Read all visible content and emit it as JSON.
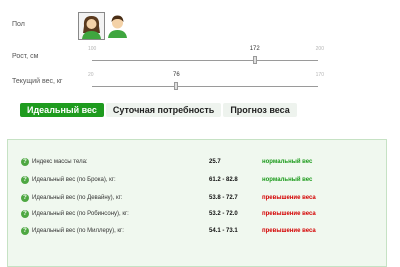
{
  "form": {
    "gender_label": "Пол",
    "height_label": "Рост, см",
    "weight_label": "Текущий вес, кг"
  },
  "gender": {
    "options": [
      "female",
      "male"
    ],
    "selected": "female"
  },
  "height_slider": {
    "min": "100",
    "max": "200",
    "value": "172"
  },
  "weight_slider": {
    "min": "20",
    "max": "170",
    "value": "76"
  },
  "tabs": [
    {
      "label": "Идеальный вес",
      "active": true
    },
    {
      "label": "Суточная потребность",
      "active": false
    },
    {
      "label": "Прогноз веса",
      "active": false
    }
  ],
  "colors": {
    "accent": "#1e9b1e",
    "ok": "#1a9a1a",
    "over": "#d40000"
  },
  "results": [
    {
      "label": "Индекс массы тела:",
      "value": "25.7",
      "status": "нормальный вес",
      "status_type": "ok"
    },
    {
      "label": "Идеальный вес (по Брока), кг:",
      "value": "61.2 - 82.8",
      "status": "нормальный вес",
      "status_type": "ok"
    },
    {
      "label": "Идеальный вес (по Девайну), кг:",
      "value": "53.8 - 72.7",
      "status": "превышение веса",
      "status_type": "over"
    },
    {
      "label": "Идеальный вес (по Робинсону), кг:",
      "value": "53.2 - 72.0",
      "status": "превышение веса",
      "status_type": "over"
    },
    {
      "label": "Идеальный вес (по Миллеру), кг:",
      "value": "54.1 - 73.1",
      "status": "превышение веса",
      "status_type": "over"
    }
  ],
  "help_icon": "question-circle-icon"
}
